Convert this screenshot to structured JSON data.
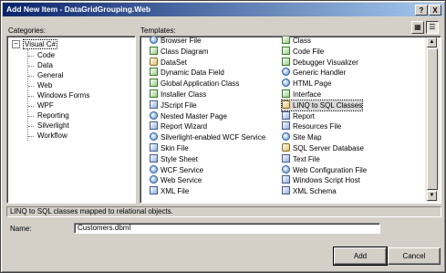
{
  "window": {
    "title": "Add New Item - DataGridGrouping.Web",
    "help_glyph": "?",
    "close_glyph": "X"
  },
  "categories": {
    "label": "Categories:",
    "root": "Visual C#",
    "expander_glyph": "−",
    "items": [
      "Code",
      "Data",
      "General",
      "Web",
      "Windows Forms",
      "WPF",
      "Reporting",
      "Silverlight",
      "Workflow"
    ]
  },
  "templates": {
    "label": "Templates:",
    "view_large_glyph": "▦",
    "view_small_glyph": "☰",
    "left_column": [
      {
        "label": "Browser File",
        "icon": "web"
      },
      {
        "label": "Class Diagram",
        "icon": "cs"
      },
      {
        "label": "DataSet",
        "icon": "db"
      },
      {
        "label": "Dynamic Data Field",
        "icon": "cs"
      },
      {
        "label": "Global Application Class",
        "icon": "cs"
      },
      {
        "label": "Installer Class",
        "icon": "cs"
      },
      {
        "label": "JScript File",
        "icon": "doc"
      },
      {
        "label": "Nested Master Page",
        "icon": "web"
      },
      {
        "label": "Report Wizard",
        "icon": "doc"
      },
      {
        "label": "Silverlight-enabled WCF Service",
        "icon": "web"
      },
      {
        "label": "Skin File",
        "icon": "doc"
      },
      {
        "label": "Style Sheet",
        "icon": "doc"
      },
      {
        "label": "WCF Service",
        "icon": "web"
      },
      {
        "label": "Web Service",
        "icon": "web"
      },
      {
        "label": "XML File",
        "icon": "doc"
      }
    ],
    "right_column": [
      {
        "label": "Class",
        "icon": "cs"
      },
      {
        "label": "Code File",
        "icon": "cs"
      },
      {
        "label": "Debugger Visualizer",
        "icon": "cs"
      },
      {
        "label": "Generic Handler",
        "icon": "web"
      },
      {
        "label": "HTML Page",
        "icon": "web"
      },
      {
        "label": "Interface",
        "icon": "cs"
      },
      {
        "label": "LINQ to SQL Classes",
        "icon": "db",
        "selected": true
      },
      {
        "label": "Report",
        "icon": "doc"
      },
      {
        "label": "Resources File",
        "icon": "doc"
      },
      {
        "label": "Site Map",
        "icon": "web"
      },
      {
        "label": "SQL Server Database",
        "icon": "db"
      },
      {
        "label": "Text File",
        "icon": "doc"
      },
      {
        "label": "Web Configuration File",
        "icon": "web"
      },
      {
        "label": "Windows Script Host",
        "icon": "doc"
      },
      {
        "label": "XML Schema",
        "icon": "doc"
      }
    ]
  },
  "description": "LINQ to SQL classes mapped to relational objects.",
  "name_field": {
    "label": "Name:",
    "value": "Customers.dbml"
  },
  "buttons": {
    "add": "Add",
    "cancel": "Cancel"
  }
}
